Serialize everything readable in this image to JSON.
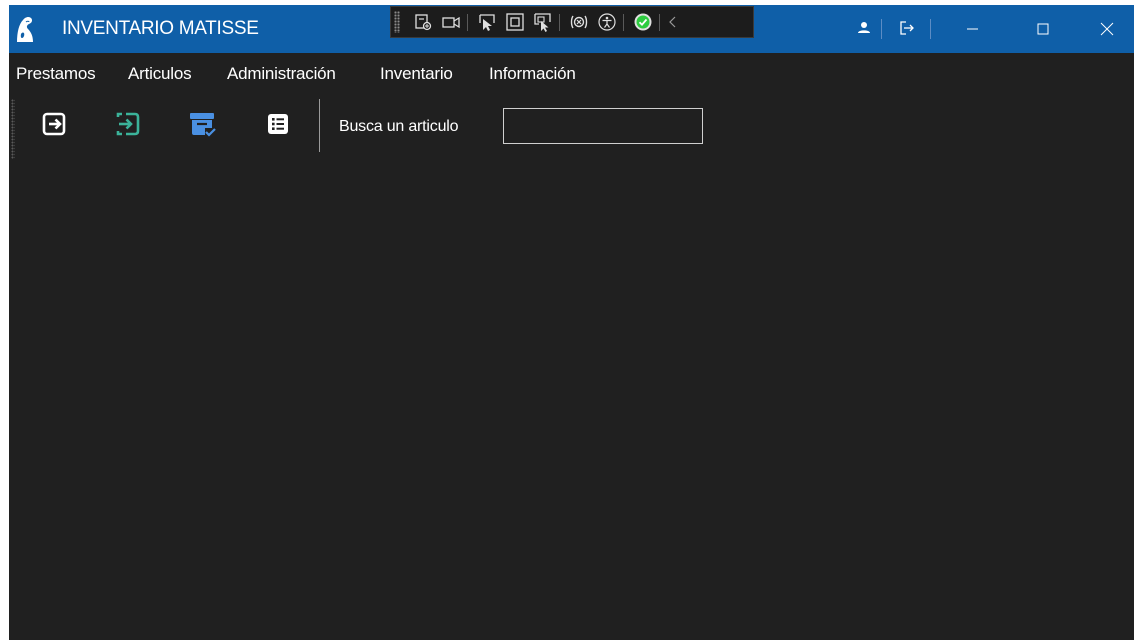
{
  "app": {
    "title": "INVENTARIO MATISSE"
  },
  "menu": {
    "items": [
      "Prestamos",
      "Articulos",
      "Administración",
      "Inventario",
      "Información"
    ]
  },
  "toolbar": {
    "buttons": [
      {
        "icon": "export-icon",
        "color": "#ffffff"
      },
      {
        "icon": "import-icon",
        "color": "#3bb39a"
      },
      {
        "icon": "archive-check-icon",
        "color": "#4a90e2"
      },
      {
        "icon": "list-icon",
        "color": "#ffffff"
      }
    ]
  },
  "search": {
    "label": "Busca un articulo",
    "value": "",
    "placeholder": ""
  },
  "colors": {
    "titlebar": "#0f5fa8",
    "background": "#202020",
    "accent_green": "#3bb39a",
    "accent_blue": "#4a90e2",
    "success": "#2ecc40"
  }
}
